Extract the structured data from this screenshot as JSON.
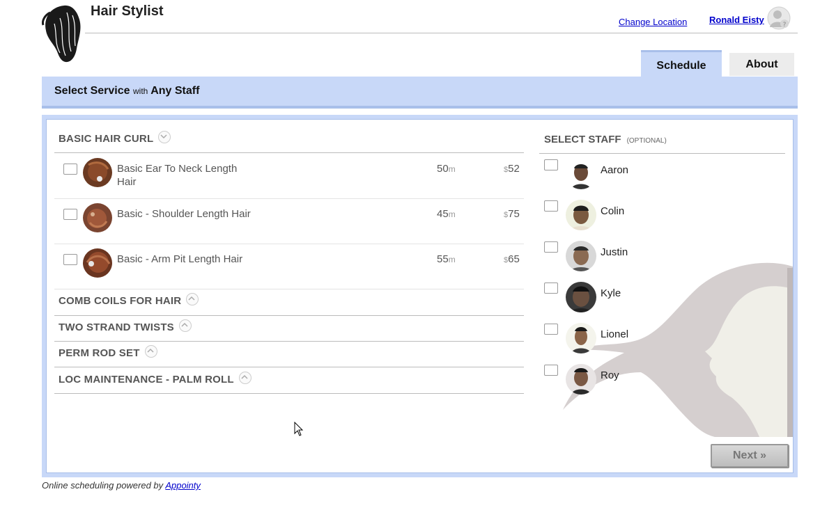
{
  "header": {
    "title": "Hair Stylist",
    "change_location": "Change Location",
    "user_name": "Ronald Eisty"
  },
  "tabs": [
    {
      "label": "Schedule",
      "active": true
    },
    {
      "label": "About",
      "active": false
    }
  ],
  "service_bar": {
    "prefix": "Select Service",
    "with": "with",
    "staff": "Any Staff"
  },
  "categories": [
    {
      "name": "BASIC HAIR CURL",
      "expanded": true,
      "services": [
        {
          "name": "Basic Ear To Neck Length Hair",
          "duration": "50",
          "duration_unit": "m",
          "currency": "$",
          "price": "52"
        },
        {
          "name": "Basic - Shoulder Length Hair",
          "duration": "45",
          "duration_unit": "m",
          "currency": "$",
          "price": "75"
        },
        {
          "name": "Basic - Arm Pit Length Hair",
          "duration": "55",
          "duration_unit": "m",
          "currency": "$",
          "price": "65"
        }
      ]
    },
    {
      "name": "COMB COILS FOR HAIR",
      "expanded": false
    },
    {
      "name": "TWO STRAND TWISTS",
      "expanded": false
    },
    {
      "name": "PERM ROD SET",
      "expanded": false
    },
    {
      "name": "LOC MAINTENANCE - PALM ROLL",
      "expanded": false
    }
  ],
  "staff": {
    "heading": "SELECT STAFF",
    "optional": "(OPTIONAL)",
    "members": [
      "Aaron",
      "Colin",
      "Justin",
      "Kyle",
      "Lionel",
      "Roy"
    ]
  },
  "next_button": "Next »",
  "footer": {
    "text": "Online scheduling powered by",
    "link": "Appointy"
  },
  "colors": {
    "accent_bg": "#c8d8f8",
    "accent_border": "#a8bfea",
    "link": "#0000cc"
  }
}
